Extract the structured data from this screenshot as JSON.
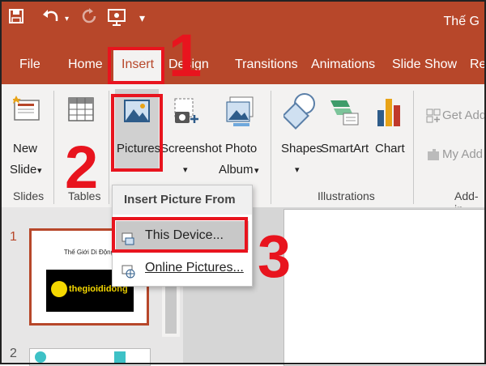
{
  "window": {
    "title": "Thế G"
  },
  "menu": [
    "File",
    "Home",
    "Insert",
    "Design",
    "Transitions",
    "Animations",
    "Slide Show",
    "Re"
  ],
  "ribbon": {
    "new_slide": [
      "New",
      "Slide"
    ],
    "pictures": "Pictures",
    "screenshot": "Screenshot",
    "photo_album": [
      "Photo",
      "Album"
    ],
    "shapes": "Shapes",
    "smartart": "SmartArt",
    "chart": "Chart",
    "get_addins": "Get Add",
    "my_addins": "My Add",
    "groups": {
      "slides": "Slides",
      "tables": "Tables",
      "illustrations": "Illustrations",
      "addins": "Add-in"
    }
  },
  "dropdown": {
    "header": "Insert Picture From",
    "items": [
      "This Device...",
      "Online Pictures..."
    ]
  },
  "thumbnails": {
    "numbers": [
      "1",
      "2"
    ],
    "slide1_title": "Thế Giới Di Động",
    "slide1_logo": "thegioididong"
  },
  "steps": [
    "1",
    "2",
    "3"
  ],
  "colors": {
    "accent": "#b7472a",
    "callout": "#e8141e",
    "ribbon": "#f3f2f1"
  }
}
